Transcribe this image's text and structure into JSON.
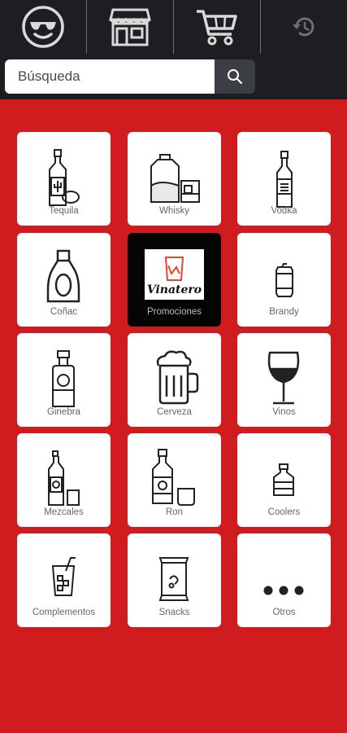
{
  "topnav": {
    "items": [
      {
        "icon": "smiley-sunglasses-icon"
      },
      {
        "icon": "store-icon"
      },
      {
        "icon": "cart-icon"
      },
      {
        "icon": "history-icon"
      }
    ]
  },
  "search": {
    "placeholder": "Búsqueda",
    "value": "",
    "button_icon": "search-icon"
  },
  "categories": [
    {
      "label": "Tequila",
      "icon": "tequila-bottle-icon"
    },
    {
      "label": "Whisky",
      "icon": "whisky-decanter-icon"
    },
    {
      "label": "Vodka",
      "icon": "vodka-bottle-icon"
    },
    {
      "label": "Coñac",
      "icon": "cognac-bottle-icon"
    },
    {
      "label": "Promociones",
      "icon": "promotions-logo",
      "logo_text": "Vinatero"
    },
    {
      "label": "Brandy",
      "icon": "brandy-can-icon"
    },
    {
      "label": "Ginebra",
      "icon": "gin-bottle-icon"
    },
    {
      "label": "Cerveza",
      "icon": "beer-mug-icon"
    },
    {
      "label": "Vinos",
      "icon": "wine-glass-icon"
    },
    {
      "label": "Mezcales",
      "icon": "mezcal-bottle-icon"
    },
    {
      "label": "Ron",
      "icon": "rum-bottle-icon"
    },
    {
      "label": "Coolers",
      "icon": "cooler-bottle-icon"
    },
    {
      "label": "Complementos",
      "icon": "mixer-glass-icon"
    },
    {
      "label": "Snacks",
      "icon": "snack-bag-icon"
    },
    {
      "label": "Otros",
      "icon": "more-dots-icon"
    }
  ],
  "colors": {
    "topbar": "#1c1e21",
    "background": "#d01c1f",
    "tile": "#ffffff",
    "promo_tile": "#050505",
    "promo_accent": "#e8452a"
  }
}
